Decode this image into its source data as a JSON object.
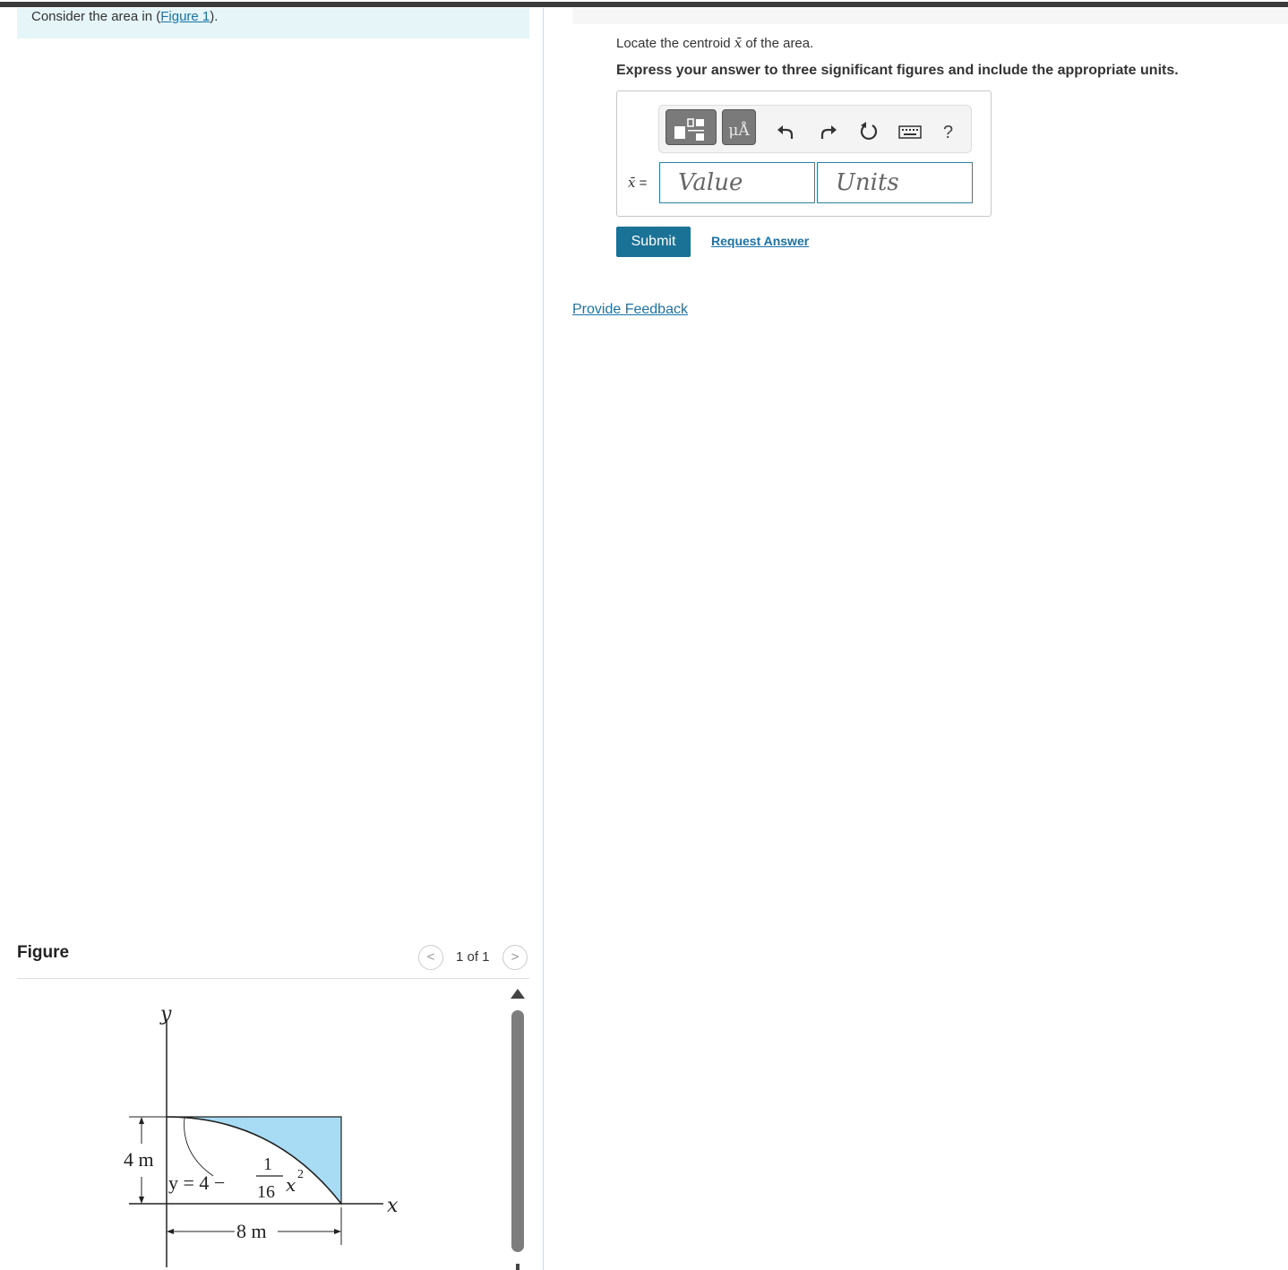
{
  "intro": {
    "prefix": "Consider the area in (",
    "link": "Figure 1",
    "suffix": ")."
  },
  "question": {
    "prefix": "Locate the centroid ",
    "variable": "x̄",
    "suffix": " of the area.",
    "instruction": "Express your answer to three significant figures and include the appropriate units."
  },
  "toolbar": {
    "units_button": "μÅ",
    "help": "?",
    "icons": [
      "templates-icon",
      "units-icon",
      "undo-icon",
      "redo-icon",
      "reset-icon",
      "keyboard-icon",
      "help-icon"
    ]
  },
  "answer": {
    "label_var": "x̄",
    "label_eq": " =",
    "value_placeholder": "Value",
    "units_placeholder": "Units"
  },
  "actions": {
    "submit": "Submit",
    "request_answer": "Request Answer",
    "provide_feedback": "Provide Feedback"
  },
  "figure": {
    "title": "Figure",
    "counter": "1 of 1",
    "prev": "<",
    "next": ">",
    "labels": {
      "y_axis": "y",
      "x_axis": "x",
      "height": "4 m",
      "width": "8 m",
      "eq_prefix": "y = 4 −",
      "frac_num": "1",
      "frac_den": "16",
      "eq_suffix": "x",
      "exponent": "2"
    },
    "fill_color": "#a8dcf5"
  }
}
